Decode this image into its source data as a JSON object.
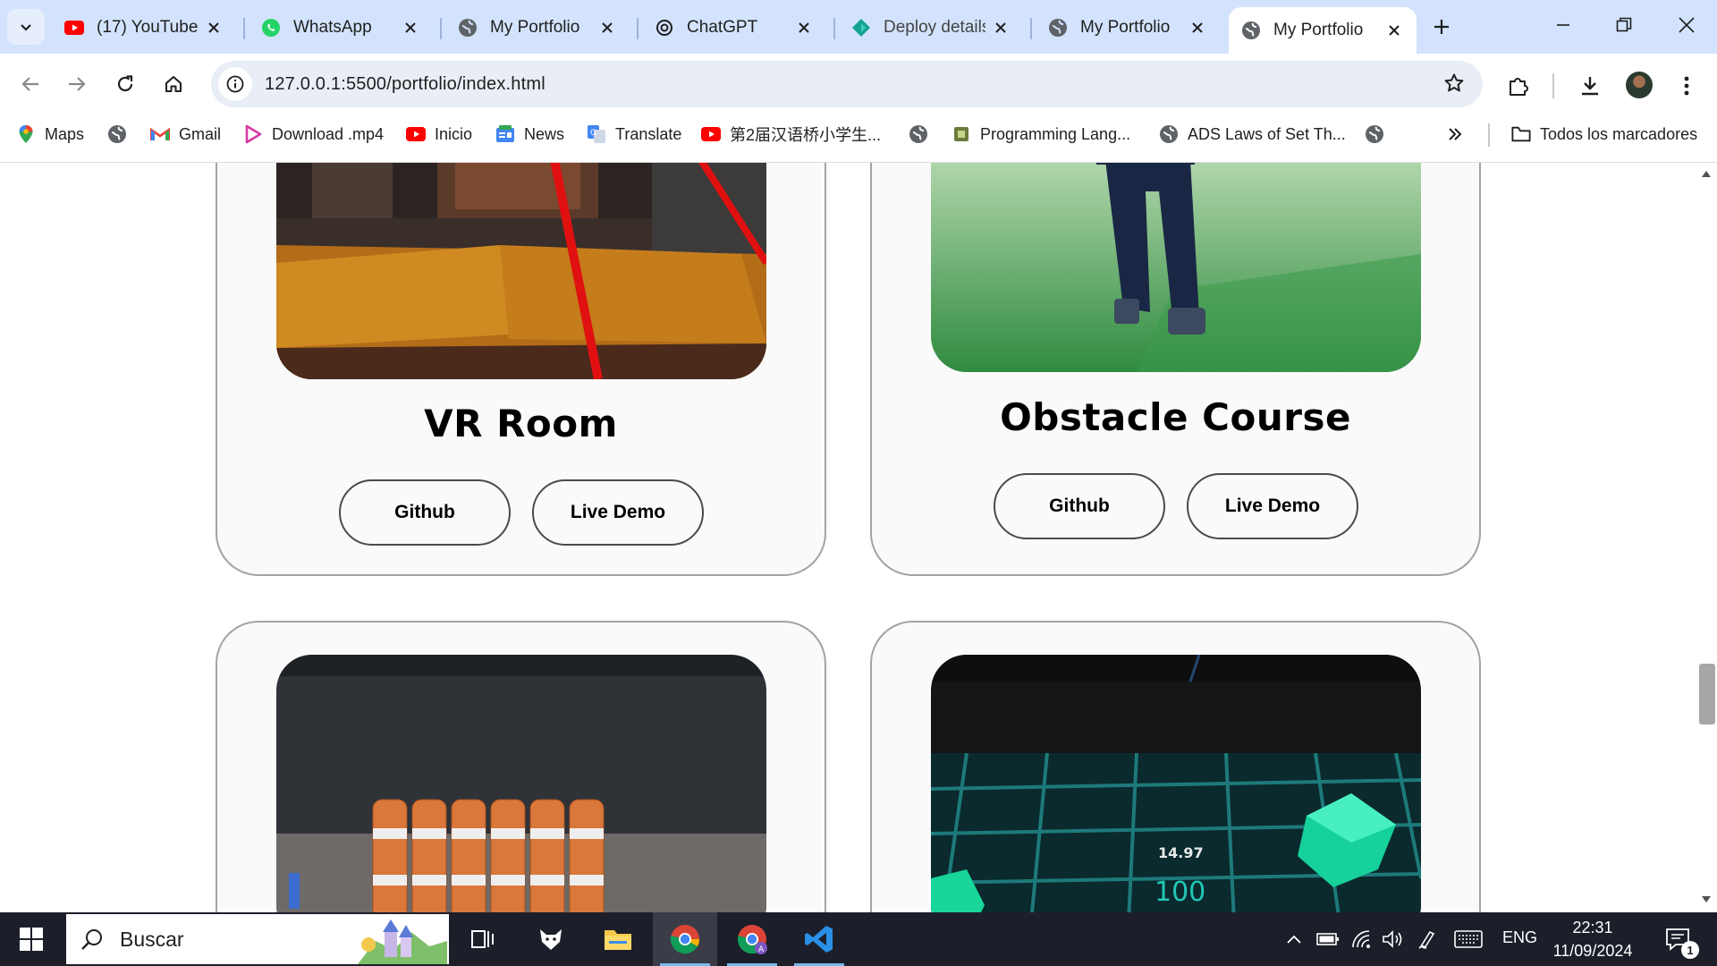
{
  "browser": {
    "tabs": [
      {
        "title": "(17) YouTube",
        "icon": "youtube-icon",
        "active": false
      },
      {
        "title": "WhatsApp",
        "icon": "whatsapp-icon",
        "active": false
      },
      {
        "title": "My Portfolio",
        "icon": "globe-icon",
        "active": false
      },
      {
        "title": "ChatGPT",
        "icon": "chatgpt-icon",
        "active": false
      },
      {
        "title": "Deploy details",
        "icon": "netlify-icon",
        "active": false
      },
      {
        "title": "My Portfolio",
        "icon": "globe-icon",
        "active": false
      },
      {
        "title": "My Portfolio",
        "icon": "globe-icon",
        "active": true
      }
    ],
    "url": "127.0.0.1:5500/portfolio/index.html",
    "bookmarks": [
      {
        "label": "Maps",
        "icon": "maps-icon"
      },
      {
        "label": "",
        "icon": "globe-icon"
      },
      {
        "label": "Gmail",
        "icon": "gmail-icon"
      },
      {
        "label": "Download .mp4",
        "icon": "download-mp4-icon"
      },
      {
        "label": "Inicio",
        "icon": "youtube-icon"
      },
      {
        "label": "News",
        "icon": "google-news-icon"
      },
      {
        "label": "Translate",
        "icon": "translate-icon"
      },
      {
        "label": "第2届汉语桥小学生...",
        "icon": "youtube-icon"
      },
      {
        "label": "",
        "icon": "globe-icon"
      },
      {
        "label": "Programming Lang...",
        "icon": "chip-icon"
      },
      {
        "label": "ADS Laws of Set Th...",
        "icon": "globe-icon"
      },
      {
        "label": "",
        "icon": "globe-icon"
      }
    ],
    "all_bookmarks_label": "Todos los marcadores"
  },
  "projects": [
    {
      "title": "VR Room",
      "github_label": "Github",
      "demo_label": "Live Demo"
    },
    {
      "title": "Obstacle Course",
      "github_label": "Github",
      "demo_label": "Live Demo"
    },
    {
      "title": "",
      "github_label": "",
      "demo_label": ""
    },
    {
      "title": "",
      "github_label": "",
      "demo_label": ""
    }
  ],
  "game_hud": {
    "timer": "14.97",
    "score": "100"
  },
  "taskbar": {
    "search_placeholder": "Buscar",
    "language": "ENG",
    "time": "22:31",
    "date": "11/09/2024",
    "notification_count": "1"
  },
  "colors": {
    "tabstrip": "#d3e3fd",
    "omnibox": "#e9eef6",
    "card_border": "#a3a3a3",
    "taskbar": "#1c1f2a",
    "accent_blue": "#0b57d0"
  }
}
